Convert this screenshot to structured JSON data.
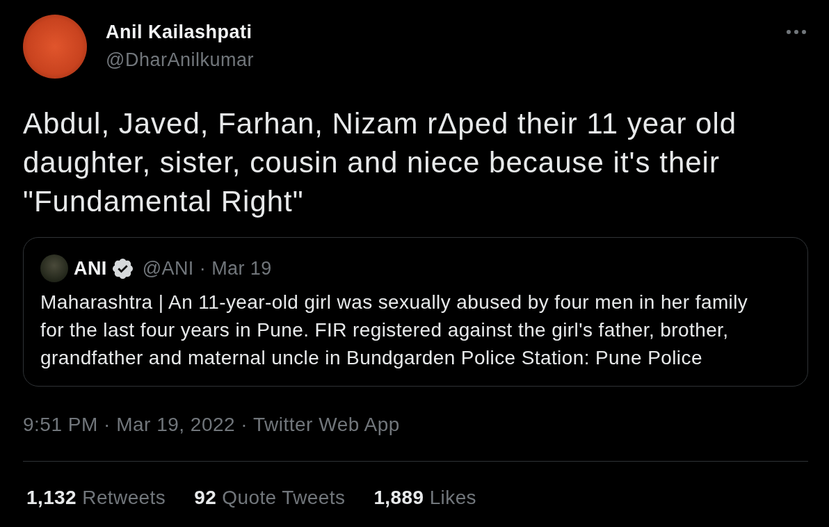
{
  "author": {
    "name": "Anil Kailashpati",
    "handle": "@DharAnilkumar"
  },
  "text": "Abdul, Javed, Farhan, Nizam rΔped their 11 year old daughter, sister, cousin and niece because it's their \"Fundamental Right\"",
  "quoted_tweet": {
    "author": {
      "name": "ANI",
      "handle": "@ANI",
      "verified": true
    },
    "separator": "·",
    "date": "Mar 19",
    "text": "Maharashtra | An 11-year-old girl was sexually abused by four men in her family for the last four years in Pune. FIR registered against the girl's father, brother, grandfather and maternal uncle in Bundgarden Police Station: Pune Police"
  },
  "meta": {
    "timestamp": "9:51 PM · Mar 19, 2022",
    "separator": "·",
    "source": "Twitter Web App"
  },
  "stats": [
    {
      "count": "1,132",
      "label": "Retweets"
    },
    {
      "count": "92",
      "label": "Quote Tweets"
    },
    {
      "count": "1,889",
      "label": "Likes"
    }
  ]
}
